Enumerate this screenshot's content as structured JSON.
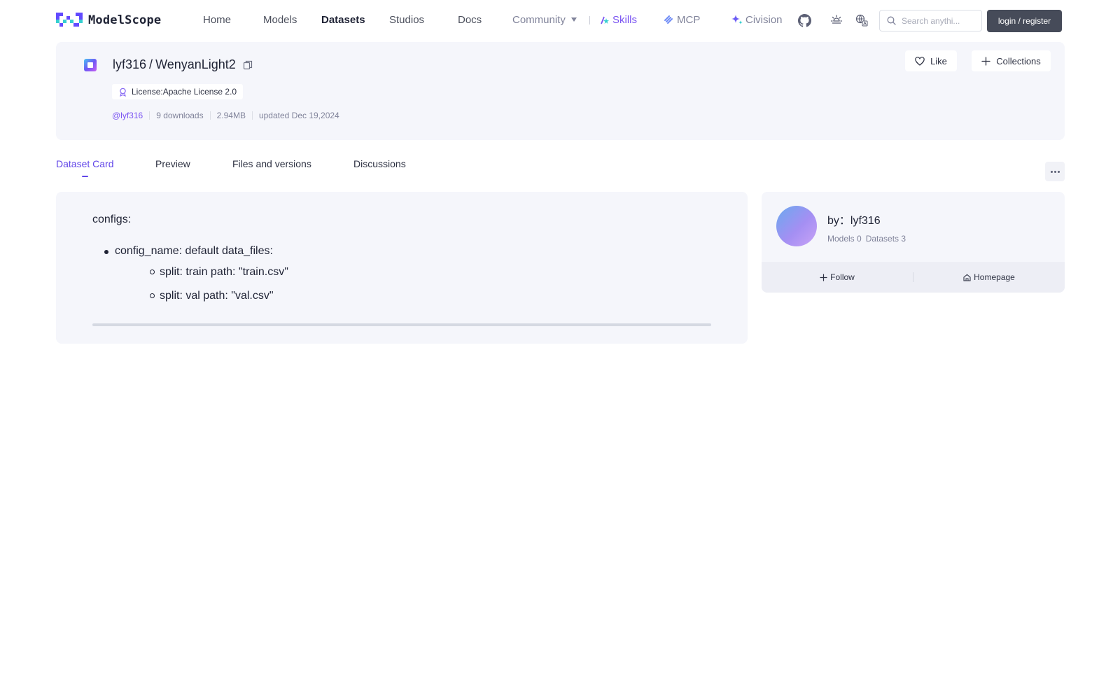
{
  "brand": {
    "name": "ModelScope"
  },
  "nav": {
    "items": [
      {
        "label": "Home"
      },
      {
        "label": "Models"
      },
      {
        "label": "Datasets"
      },
      {
        "label": "Studios"
      },
      {
        "label": "Docs"
      },
      {
        "label": "Community"
      }
    ],
    "skills": "Skills",
    "mcp": "MCP",
    "civision": "Civision",
    "search_placeholder": "Search anythi...",
    "login": "login / register"
  },
  "dataset": {
    "owner": "lyf316",
    "separator": "/",
    "name": "WenyanLight2",
    "license": "License:Apache License 2.0",
    "owner_handle": "@lyf316",
    "downloads": "9 downloads",
    "size": "2.94MB",
    "updated": "updated Dec 19,2024"
  },
  "actions": {
    "like": "Like",
    "collections": "Collections"
  },
  "tabs": [
    {
      "label": "Dataset Card",
      "active": true
    },
    {
      "label": "Preview"
    },
    {
      "label": "Files and versions"
    },
    {
      "label": "Discussions"
    }
  ],
  "card": {
    "configs_heading": "configs:",
    "item": "config_name: default data_files:",
    "sub": [
      "split: train path: \"train.csv\"",
      "split: val path: \"val.csv\""
    ]
  },
  "author": {
    "by": "by：lyf316",
    "models": "Models 0",
    "datasets": "Datasets 3",
    "follow": "Follow",
    "homepage": "Homepage"
  },
  "colors": {
    "accent": "#6146e8",
    "brand_purple": "#7b55f2",
    "login_bg": "#464b59",
    "card_bg": "#f5f6fb"
  }
}
